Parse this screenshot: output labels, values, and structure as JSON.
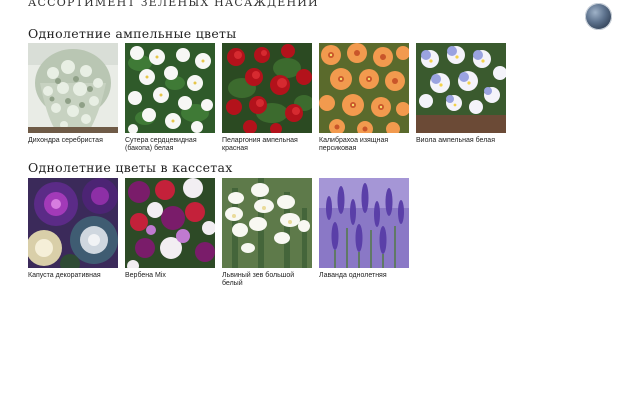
{
  "header": {
    "title": "Ассортимент зеленых насаждений"
  },
  "sections": [
    {
      "title": "Однолетние ампельные цветы",
      "items": [
        {
          "label": "Дихондра серебристая"
        },
        {
          "label": "Сутера сердцевидная (бакопа) белая"
        },
        {
          "label": "Пеларгония ампельная красная"
        },
        {
          "label": "Калибрахоа изящная персиковая"
        },
        {
          "label": "Виола ампельная белая"
        }
      ]
    },
    {
      "title": "Однолетние цветы в кассетах",
      "items": [
        {
          "label": "Капуста декоративная"
        },
        {
          "label": "Вербена Mix"
        },
        {
          "label": "Львиный зев большой белый"
        },
        {
          "label": "Лаванда однолетняя"
        }
      ]
    }
  ]
}
